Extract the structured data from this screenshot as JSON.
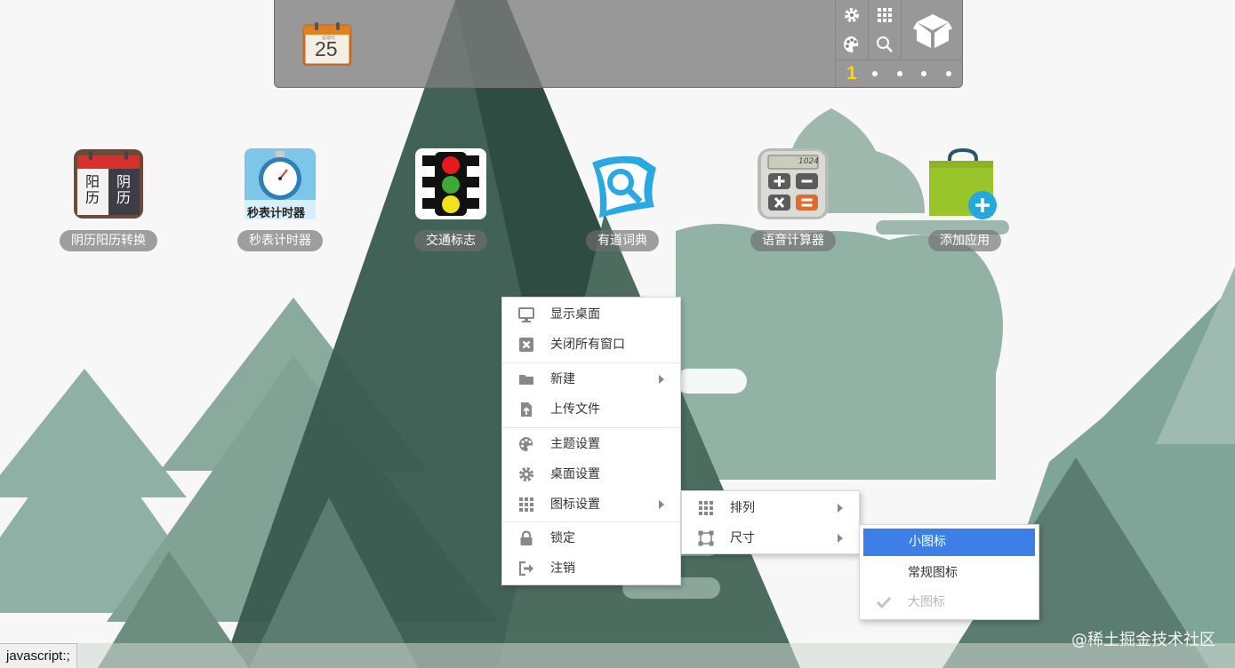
{
  "dock": {
    "calendar_day": "25",
    "calendar_tag": "星期日",
    "tools": [
      "settings-icon",
      "apps-grid-icon",
      "theme-palette-icon",
      "search-icon"
    ],
    "app_box_icon": "cube-box-icon",
    "current_page": "1",
    "page_dots": 4
  },
  "apps": [
    {
      "label": "阴历阳历转换",
      "icon": "lunar-calendar-icon",
      "glyphs": [
        "阳",
        "阴",
        "历",
        "历"
      ]
    },
    {
      "label": "秒表计时器",
      "icon": "stopwatch-icon",
      "caption": "秒表计时器"
    },
    {
      "label": "交通标志",
      "icon": "traffic-light-icon"
    },
    {
      "label": "有道词典",
      "icon": "youdao-dictionary-icon"
    },
    {
      "label": "语音计算器",
      "icon": "calculator-icon",
      "display": "1024"
    },
    {
      "label": "添加应用",
      "icon": "add-app-bag-icon"
    }
  ],
  "context_menu": {
    "items": [
      {
        "label": "显示桌面",
        "icon": "monitor-icon"
      },
      {
        "label": "关闭所有窗口",
        "icon": "close-box-icon"
      },
      {
        "label": "新建",
        "icon": "folder-icon",
        "submenu": true
      },
      {
        "label": "上传文件",
        "icon": "upload-file-icon"
      },
      {
        "label": "主题设置",
        "icon": "palette-icon"
      },
      {
        "label": "桌面设置",
        "icon": "gear-icon"
      },
      {
        "label": "图标设置",
        "icon": "grid-icon",
        "submenu": true
      },
      {
        "label": "锁定",
        "icon": "lock-icon"
      },
      {
        "label": "注销",
        "icon": "sign-out-icon"
      }
    ]
  },
  "icon_submenu": {
    "items": [
      {
        "label": "排列",
        "icon": "grid-icon",
        "submenu": true
      },
      {
        "label": "尺寸",
        "icon": "resize-icon",
        "submenu": true
      }
    ]
  },
  "size_submenu": {
    "items": [
      {
        "label": "小图标",
        "state": "hovered"
      },
      {
        "label": "常规图标",
        "state": "normal"
      },
      {
        "label": "大图标",
        "state": "checked-disabled",
        "icon": "check-icon"
      }
    ]
  },
  "status_bar": {
    "text": "javascript:;"
  },
  "watermark": "@稀土掘金技术社区",
  "colors": {
    "highlight": "#3c7fe6",
    "dock": "#7d7d7d",
    "tree_dark": "#2e4a40",
    "tree_light": "#7fa598"
  }
}
